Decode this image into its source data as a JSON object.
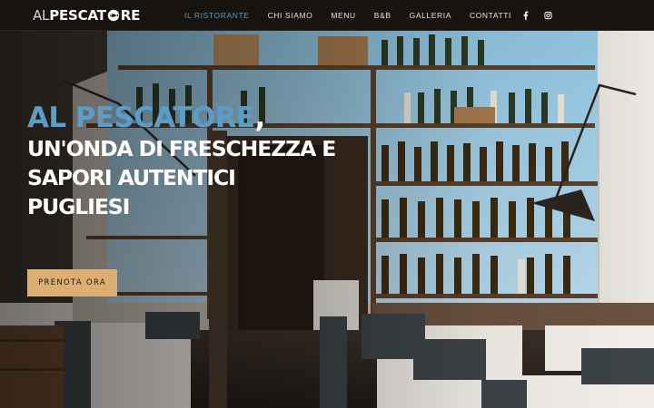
{
  "brand": {
    "logo_prefix": "AL",
    "logo_main_a": "PESCAT",
    "logo_main_b": "RE"
  },
  "nav": {
    "items": [
      {
        "label": "IL RISTORANTE",
        "active": true
      },
      {
        "label": "CHI SIAMO",
        "active": false
      },
      {
        "label": "MENU",
        "active": false
      },
      {
        "label": "B&B",
        "active": false
      },
      {
        "label": "GALLERIA",
        "active": false
      },
      {
        "label": "CONTATTI",
        "active": false
      }
    ]
  },
  "socials": [
    {
      "icon": "facebook-icon"
    },
    {
      "icon": "instagram-icon"
    }
  ],
  "hero": {
    "title": "AL PESCATORE",
    "title_punct": ",",
    "subtitle_lines": [
      "UN'ONDA DI FRESCHEZZA E",
      "SAPORI AUTENTICI",
      "PUGLIESI"
    ],
    "cta_label": "PRENOTA ORA"
  },
  "colors": {
    "accent": "#5d9cc6",
    "cta": "#dcae73",
    "header_bg": "#17130f"
  }
}
